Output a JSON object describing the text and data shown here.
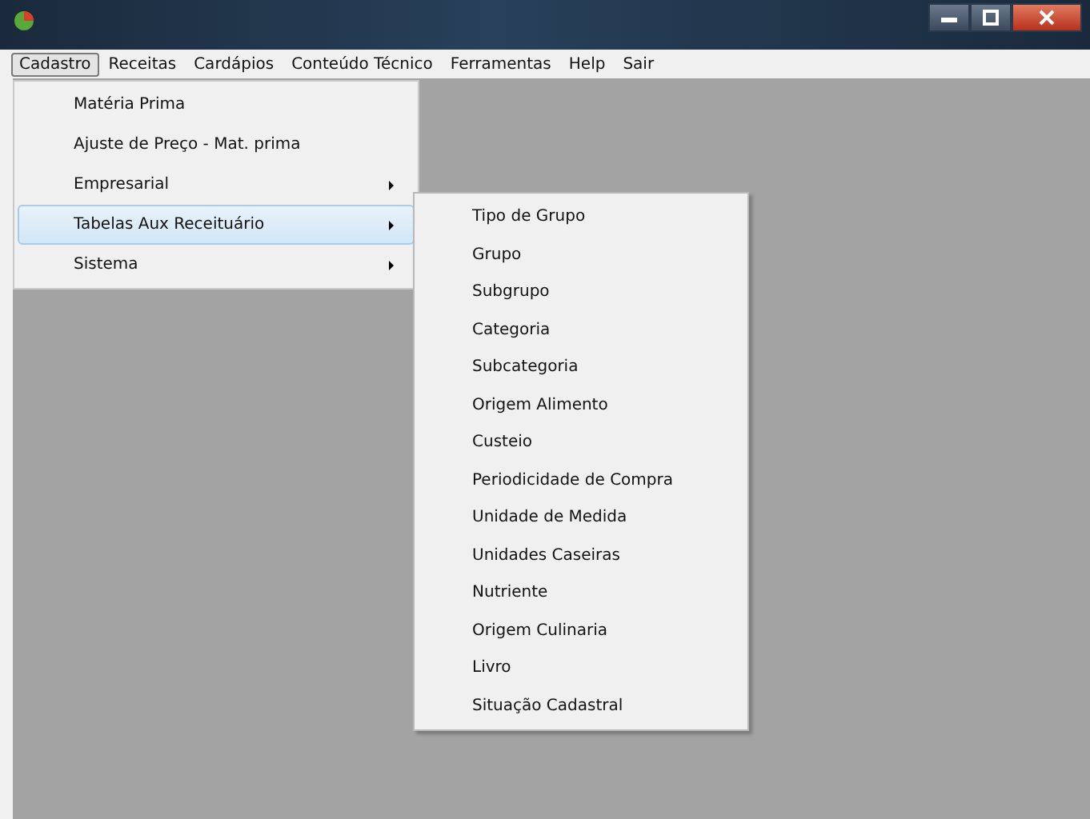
{
  "menu_bar": [
    {
      "label": "Cadastro",
      "selected": true
    },
    {
      "label": "Receitas",
      "selected": false
    },
    {
      "label": "Cardápios",
      "selected": false
    },
    {
      "label": "Conteúdo Técnico",
      "selected": false
    },
    {
      "label": "Ferramentas",
      "selected": false
    },
    {
      "label": "Help",
      "selected": false
    },
    {
      "label": "Sair",
      "selected": false
    }
  ],
  "menu": [
    {
      "label": "Matéria Prima",
      "submenu": false,
      "selected": false
    },
    {
      "label": "Ajuste de Preço - Mat. prima",
      "submenu": false,
      "selected": false
    },
    {
      "label": "Empresarial",
      "submenu": true,
      "selected": false
    },
    {
      "label": "Tabelas Aux Receituário",
      "submenu": true,
      "selected": true
    },
    {
      "label": "Sistema",
      "submenu": true,
      "selected": false
    }
  ],
  "submenu": [
    {
      "label": "Tipo de Grupo"
    },
    {
      "label": "Grupo"
    },
    {
      "label": "Subgrupo"
    },
    {
      "label": "Categoria"
    },
    {
      "label": "Subcategoria"
    },
    {
      "label": "Origem Alimento"
    },
    {
      "label": "Custeio"
    },
    {
      "label": "Periodicidade de Compra"
    },
    {
      "label": "Unidade de Medida"
    },
    {
      "label": "Unidades Caseiras"
    },
    {
      "label": "Nutriente"
    },
    {
      "label": "Origem Culinaria"
    },
    {
      "label": "Livro"
    },
    {
      "label": "Situação Cadastral"
    }
  ]
}
